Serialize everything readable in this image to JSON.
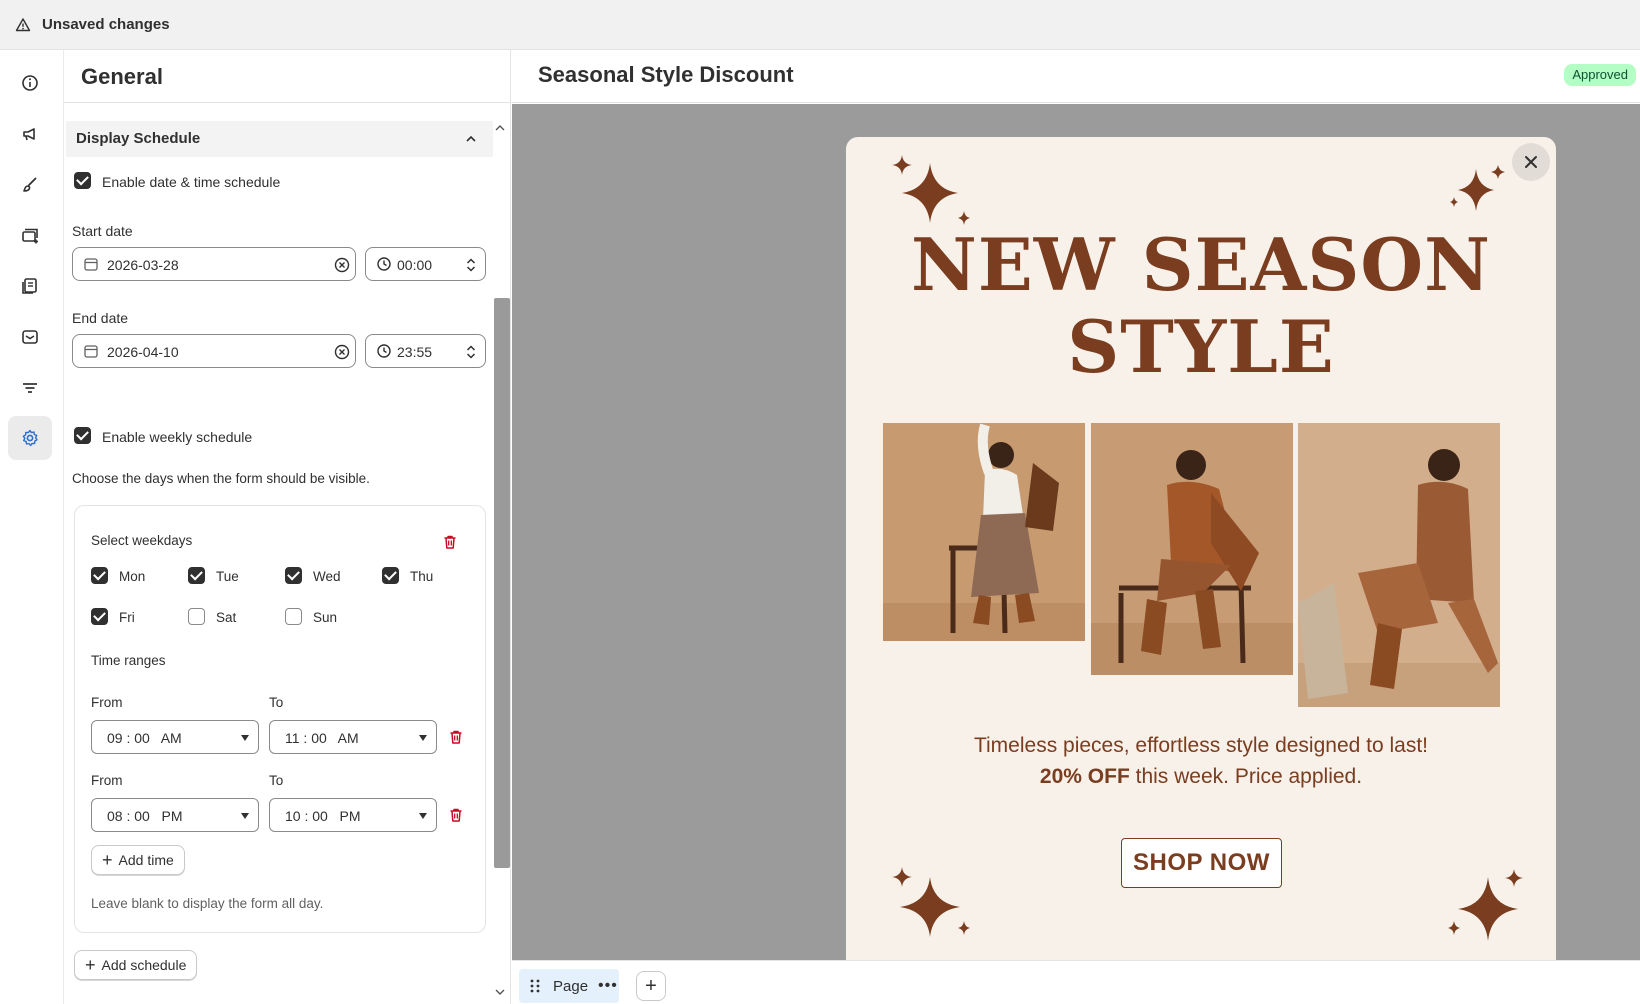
{
  "topbar": {
    "title": "Unsaved changes",
    "icon": "warning-icon"
  },
  "rail": {
    "items": [
      {
        "icon": "info-icon"
      },
      {
        "icon": "megaphone-icon"
      },
      {
        "icon": "brush-icon"
      },
      {
        "icon": "form-add-icon"
      },
      {
        "icon": "receipt-icon"
      },
      {
        "icon": "mail-icon"
      },
      {
        "icon": "filter-icon"
      },
      {
        "icon": "gear-icon",
        "active": true
      }
    ]
  },
  "panel": {
    "title": "General",
    "section": "Display Schedule",
    "enable_datetime": {
      "label": "Enable date & time schedule",
      "checked": true
    },
    "start": {
      "label": "Start date",
      "date": "2026-03-28",
      "time": "00:00"
    },
    "end": {
      "label": "End date",
      "date": "2026-04-10",
      "time": "23:55"
    },
    "enable_weekly": {
      "label": "Enable weekly schedule",
      "checked": true
    },
    "weekly_help": "Choose the days when the form should be visible.",
    "weekdays_label": "Select weekdays",
    "weekdays": [
      {
        "label": "Mon",
        "checked": true
      },
      {
        "label": "Tue",
        "checked": true
      },
      {
        "label": "Wed",
        "checked": true
      },
      {
        "label": "Thu",
        "checked": true
      },
      {
        "label": "Fri",
        "checked": true
      },
      {
        "label": "Sat",
        "checked": false
      },
      {
        "label": "Sun",
        "checked": false
      }
    ],
    "time_ranges_label": "Time ranges",
    "ranges": [
      {
        "from_label": "From",
        "from": "09 : 00   AM",
        "to_label": "To",
        "to": "11 : 00   AM"
      },
      {
        "from_label": "From",
        "from": "08 : 00   PM",
        "to_label": "To",
        "to": "10 : 00   PM"
      }
    ],
    "add_time": "Add time",
    "blank_help": "Leave blank to display the form all day.",
    "add_schedule": "Add schedule"
  },
  "preview": {
    "title": "Seasonal Style Discount",
    "status": "Approved",
    "status_color": "#b4fec5",
    "headline_line1": "NEW SEASON",
    "headline_line2": "STYLE",
    "tagline1": "Timeless pieces, effortless style designed to last!",
    "tagline2_bold": "20% OFF",
    "tagline2_rest": " this week. Price applied.",
    "cta": "SHOP NOW",
    "brand_color": "#7a3d1f"
  },
  "bottombar": {
    "page_label": "Page",
    "dots": "•••",
    "add": "+"
  }
}
